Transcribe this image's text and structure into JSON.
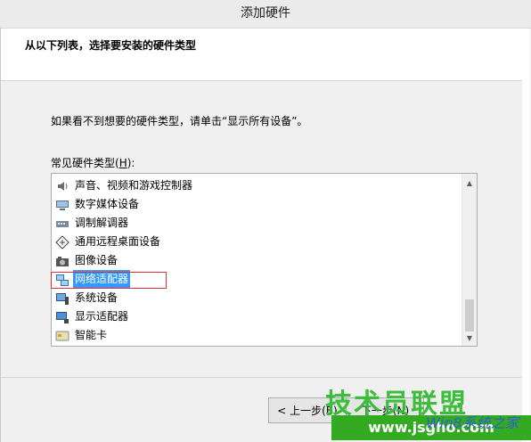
{
  "window": {
    "title": "添加硬件"
  },
  "header": {
    "title": "从以下列表，选择要安装的硬件类型"
  },
  "content": {
    "hint": "如果看不到想要的硬件类型，请单击“显示所有设备”。",
    "list_label_prefix": "常见硬件类型(",
    "list_label_key": "H",
    "list_label_suffix": "):"
  },
  "hardware_list": {
    "items": [
      {
        "label": "声音、视频和游戏控制器",
        "icon": "speaker-icon"
      },
      {
        "label": "数字媒体设备",
        "icon": "media-device-icon"
      },
      {
        "label": "调制解调器",
        "icon": "modem-icon"
      },
      {
        "label": "通用远程桌面设备",
        "icon": "remote-desktop-icon"
      },
      {
        "label": "图像设备",
        "icon": "camera-icon"
      },
      {
        "label": "网络适配器",
        "icon": "network-adapter-icon",
        "selected": true
      },
      {
        "label": "系统设备",
        "icon": "system-device-icon"
      },
      {
        "label": "显示适配器",
        "icon": "display-adapter-icon"
      },
      {
        "label": "智能卡",
        "icon": "smart-card-icon"
      }
    ]
  },
  "buttons": {
    "back": "< 上一步(B)",
    "next": "下一步(N)"
  },
  "watermark": {
    "line1": "技术员联盟",
    "line2": "www.jsgho.com",
    "line3": "Win8系统之家"
  },
  "colors": {
    "selection": "#3399ff",
    "highlight_box": "#e0303a"
  }
}
